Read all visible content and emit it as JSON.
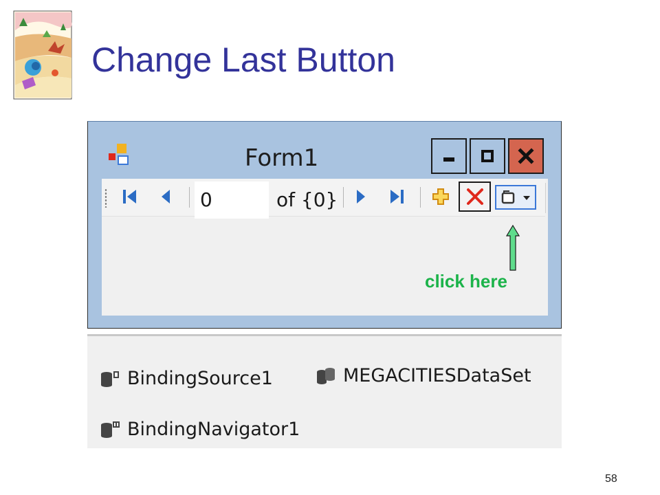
{
  "slide": {
    "title": "Change Last Button",
    "page_number": "58"
  },
  "form": {
    "title": "Form1",
    "caption_buttons": [
      "minimize-icon",
      "maximize-icon",
      "close-icon"
    ],
    "caption_close_color": "#d4654f",
    "titlebar_color": "#a9c3e0"
  },
  "navigator": {
    "position_value": "0",
    "count_text": "of {0}",
    "icons": [
      "move-first-icon",
      "move-previous-icon",
      "move-next-icon",
      "move-last-icon",
      "add-new-icon",
      "delete-icon",
      "dropdown-button-icon"
    ],
    "delete_color": "#e0281c",
    "add_color": "#e6a817"
  },
  "annotation": {
    "label": "click here",
    "color": "#1cb34a"
  },
  "component_tray": {
    "items": [
      "BindingSource1",
      "MEGACITIESDataSet",
      "BindingNavigator1"
    ]
  },
  "colors": {
    "title_text": "#33339a"
  }
}
